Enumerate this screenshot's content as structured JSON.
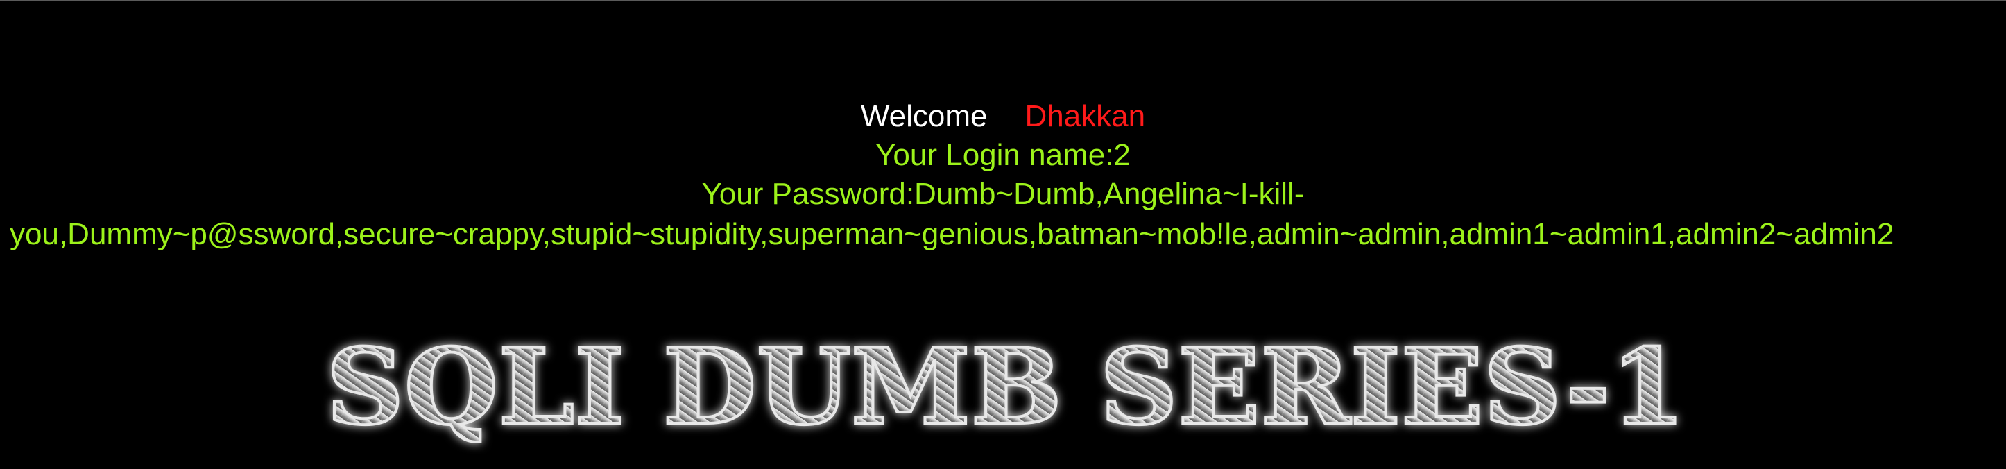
{
  "welcome": {
    "greeting": "Welcome",
    "username": "Dhakkan"
  },
  "login": {
    "text": "Your Login name:2"
  },
  "password": {
    "line1": "Your Password:Dumb~Dumb,Angelina~I-kill-",
    "line2": "you,Dummy~p@ssword,secure~crappy,stupid~stupidity,superman~genious,batman~mob!le,admin~admin,admin1~admin1,admin2~admin2"
  },
  "banner": {
    "text": "SQLI DUMB SERIES-1"
  },
  "colors": {
    "background": "#000000",
    "welcome_text": "#ffffff",
    "username": "#ff1a1a",
    "result_text": "#9cf21a"
  }
}
